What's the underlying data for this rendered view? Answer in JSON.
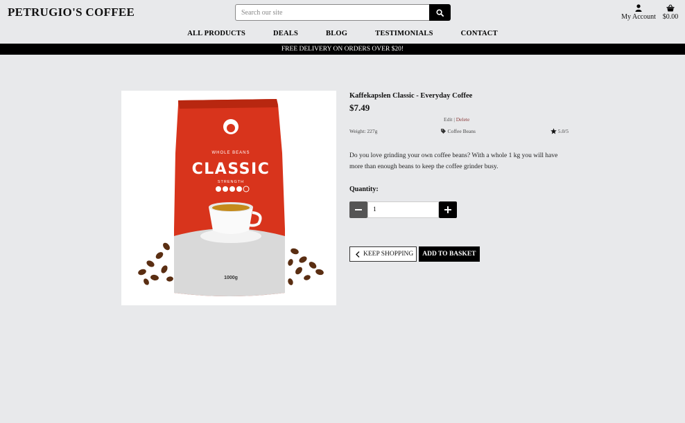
{
  "brand": {
    "name": "PETRUGIO'S COFFEE"
  },
  "search": {
    "placeholder": "Search our site",
    "button_icon": "search-icon"
  },
  "header": {
    "account_label": "My Account",
    "basket_total": "$0.00"
  },
  "nav": {
    "items": [
      {
        "label": "ALL PRODUCTS"
      },
      {
        "label": "DEALS"
      },
      {
        "label": "BLOG"
      },
      {
        "label": "TESTIMONIALS"
      },
      {
        "label": "CONTACT"
      }
    ]
  },
  "banner": {
    "text": "FREE DELIVERY ON ORDERS OVER $20!"
  },
  "product": {
    "name": "Kaffekapslen Classic - Everyday Coffee",
    "price": "$7.49",
    "edit_label": "Edit",
    "admin_separator": " | ",
    "delete_label": "Delete",
    "weight": "Weight: 227g",
    "category": "Coffee Beans",
    "rating": "5.0/5",
    "description": "Do you love grinding your own coffee beans? With a whole 1 kg you will have more than enough beans to keep the coffee grinder busy.",
    "image": {
      "bag_brand_small": "WHOLE BEANS",
      "bag_title": "CLASSIC",
      "bag_subtitle": "STRENGTH",
      "bag_weight": "1000g"
    }
  },
  "quantity": {
    "label": "Quantity:",
    "value": "1"
  },
  "actions": {
    "keep_shopping": "KEEP SHOPPING",
    "add_to_basket": "ADD TO BASKET"
  },
  "colors": {
    "banner_bg": "#000000",
    "page_bg": "#e8e9eb",
    "bag_red": "#d8341c"
  }
}
